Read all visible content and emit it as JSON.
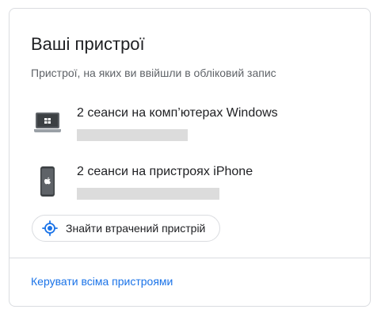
{
  "card": {
    "title": "Ваші пристрої",
    "subtitle": "Пристрої, на яких ви ввійшли в обліковий запис"
  },
  "devices": [
    {
      "icon": "laptop-icon",
      "title": "2 сеанси на комп’ютерах Windows"
    },
    {
      "icon": "phone-icon",
      "title": "2 сеанси на пристроях iPhone"
    }
  ],
  "actions": {
    "find_device_label": "Знайти втрачений пристрій",
    "find_device_icon": "locate-icon",
    "manage_devices_link": "Керувати всіма пристроями"
  },
  "colors": {
    "accent": "#1a73e8",
    "text_primary": "#202124",
    "text_secondary": "#5f6368",
    "border": "#dadce0",
    "redacted": "#dcdcdc"
  }
}
